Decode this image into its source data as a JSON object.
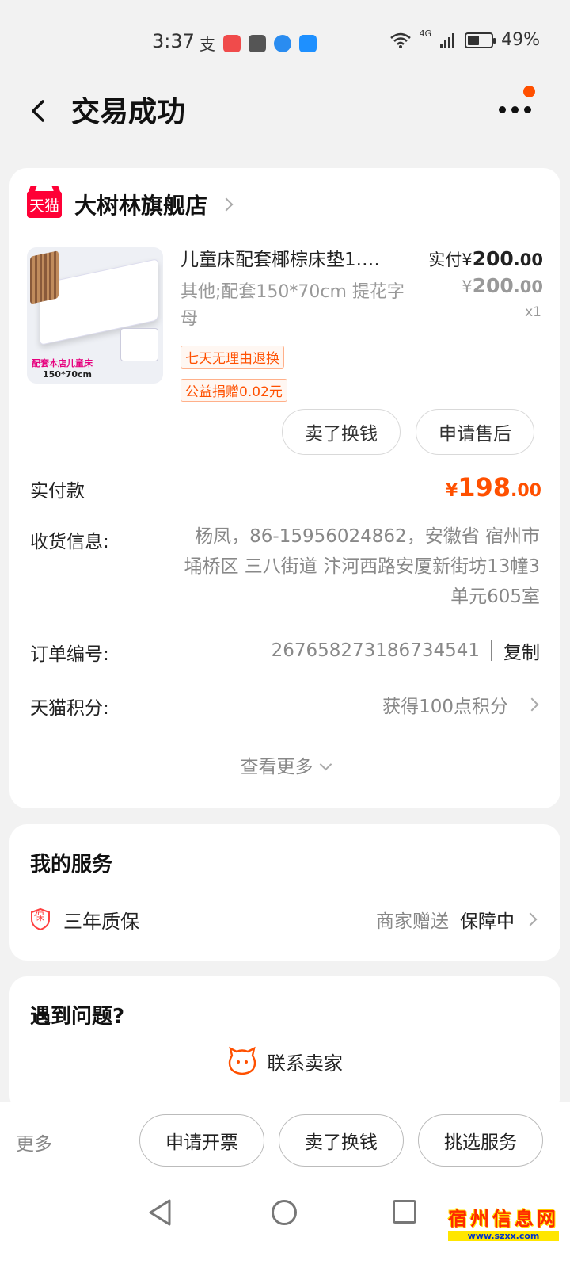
{
  "status_bar": {
    "time": "3:37",
    "battery_text": "49%",
    "battery_level": 0.49,
    "network": "4G"
  },
  "nav": {
    "title": "交易成功"
  },
  "shop": {
    "logo_text": "天猫",
    "name": "大树林旗舰店"
  },
  "product": {
    "title": "儿童床配套椰棕床垫1.…",
    "spec": "其他;配套150*70cm 提花字母",
    "tags": [
      "七天无理由退换",
      "公益捐赠0.02元"
    ],
    "paid_label": "实付",
    "paid_currency": "¥",
    "paid_int": "200",
    "paid_dec": ".00",
    "orig_currency": "¥",
    "orig_int": "200",
    "orig_dec": ".00",
    "quantity": "x1",
    "image_text_1": "配套本店儿童床",
    "image_text_2": "150*70cm",
    "actions": [
      "卖了换钱",
      "申请售后"
    ]
  },
  "order": {
    "paid_label": "实付款",
    "paid_currency": "¥",
    "paid_int": "198",
    "paid_dec": ".00",
    "address_label": "收货信息:",
    "address": "杨凤，86-15956024862，安徽省 宿州市 埇桥区 三八街道 汴河西路安厦新街坊13幢3单元605室",
    "order_no_label": "订单编号:",
    "order_no": "267658273186734541",
    "copy_label": "复制",
    "points_label": "天猫积分:",
    "points_value": "获得100点积分",
    "view_more": "查看更多"
  },
  "service": {
    "title": "我的服务",
    "icon_text": "保",
    "name": "三年质保",
    "gift": "商家赠送",
    "status": "保障中"
  },
  "help": {
    "title": "遇到问题?",
    "contact": "联系卖家"
  },
  "bottom_bar": {
    "more": "更多",
    "buttons": [
      "申请开票",
      "卖了换钱",
      "挑选服务"
    ]
  },
  "watermark": {
    "text": "宿州信息网",
    "url": "www.szxx.com"
  },
  "colors": {
    "accent": "#ff5000",
    "tmall_red": "#ff0036",
    "text_primary": "#222222",
    "text_secondary": "#888888",
    "background": "#f2f2f2"
  }
}
